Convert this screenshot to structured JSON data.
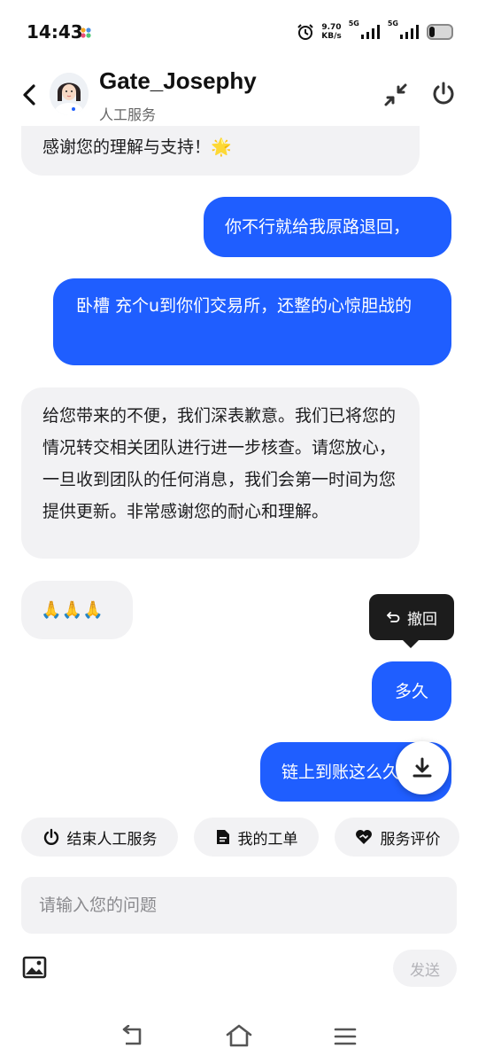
{
  "status_bar": {
    "time": "14:43",
    "net_speed_value": "9.70",
    "net_speed_unit": "KB/s",
    "sim1": "5G",
    "sim2": "5G",
    "battery_level": 0.2
  },
  "header": {
    "agent_name": "Gate_Josephy",
    "agent_subtitle": "人工服务"
  },
  "messages": [
    {
      "from": "agent",
      "text": "感谢您的理解与支持！🌟"
    },
    {
      "from": "user",
      "text": "你不行就给我原路退回，"
    },
    {
      "from": "user",
      "text": "卧槽 充个u到你们交易所，还整的心惊胆战的"
    },
    {
      "from": "agent",
      "text": "给您带来的不便，我们深表歉意。我们已将您的情况转交相关团队进行进一步核查。请您放心，一旦收到团队的任何消息，我们会第一时间为您提供更新。非常感谢您的耐心和理解。"
    },
    {
      "from": "agent",
      "text": "🙏🙏🙏"
    },
    {
      "from": "user",
      "text": "多久"
    },
    {
      "from": "user",
      "text": "链上到账这么久"
    }
  ],
  "tooltip": {
    "label": "撤回"
  },
  "quick_actions": [
    {
      "label": "结束人工服务",
      "icon": "power-icon"
    },
    {
      "label": "我的工单",
      "icon": "document-icon"
    },
    {
      "label": "服务评价",
      "icon": "heart-handshake-icon"
    }
  ],
  "composer": {
    "placeholder": "请输入您的问题",
    "send_label": "发送"
  },
  "colors": {
    "accent": "#1f5eff",
    "bubble_agent": "#f2f2f4",
    "tooltip_bg": "#1c1c1c"
  }
}
